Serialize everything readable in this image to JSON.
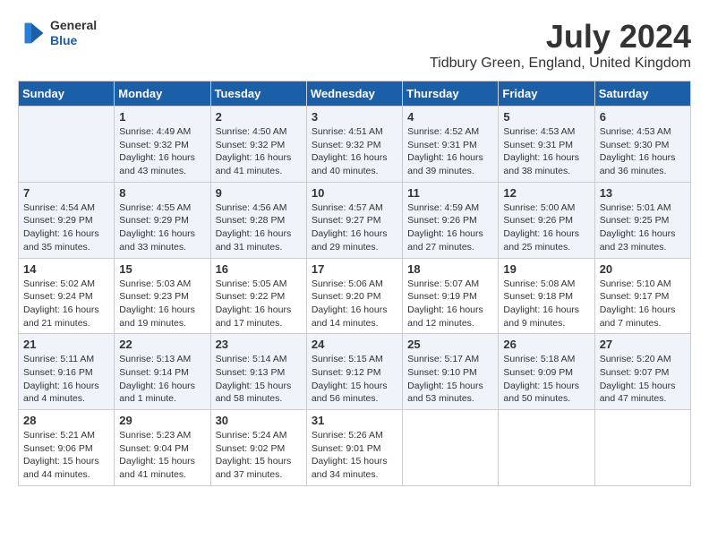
{
  "header": {
    "logo": {
      "general": "General",
      "blue": "Blue"
    },
    "title": "July 2024",
    "location": "Tidbury Green, England, United Kingdom"
  },
  "calendar": {
    "headers": [
      "Sunday",
      "Monday",
      "Tuesday",
      "Wednesday",
      "Thursday",
      "Friday",
      "Saturday"
    ],
    "weeks": [
      [
        {
          "day": "",
          "sunrise": "",
          "sunset": "",
          "daylight": ""
        },
        {
          "day": "1",
          "sunrise": "Sunrise: 4:49 AM",
          "sunset": "Sunset: 9:32 PM",
          "daylight": "Daylight: 16 hours and 43 minutes."
        },
        {
          "day": "2",
          "sunrise": "Sunrise: 4:50 AM",
          "sunset": "Sunset: 9:32 PM",
          "daylight": "Daylight: 16 hours and 41 minutes."
        },
        {
          "day": "3",
          "sunrise": "Sunrise: 4:51 AM",
          "sunset": "Sunset: 9:32 PM",
          "daylight": "Daylight: 16 hours and 40 minutes."
        },
        {
          "day": "4",
          "sunrise": "Sunrise: 4:52 AM",
          "sunset": "Sunset: 9:31 PM",
          "daylight": "Daylight: 16 hours and 39 minutes."
        },
        {
          "day": "5",
          "sunrise": "Sunrise: 4:53 AM",
          "sunset": "Sunset: 9:31 PM",
          "daylight": "Daylight: 16 hours and 38 minutes."
        },
        {
          "day": "6",
          "sunrise": "Sunrise: 4:53 AM",
          "sunset": "Sunset: 9:30 PM",
          "daylight": "Daylight: 16 hours and 36 minutes."
        }
      ],
      [
        {
          "day": "7",
          "sunrise": "Sunrise: 4:54 AM",
          "sunset": "Sunset: 9:29 PM",
          "daylight": "Daylight: 16 hours and 35 minutes."
        },
        {
          "day": "8",
          "sunrise": "Sunrise: 4:55 AM",
          "sunset": "Sunset: 9:29 PM",
          "daylight": "Daylight: 16 hours and 33 minutes."
        },
        {
          "day": "9",
          "sunrise": "Sunrise: 4:56 AM",
          "sunset": "Sunset: 9:28 PM",
          "daylight": "Daylight: 16 hours and 31 minutes."
        },
        {
          "day": "10",
          "sunrise": "Sunrise: 4:57 AM",
          "sunset": "Sunset: 9:27 PM",
          "daylight": "Daylight: 16 hours and 29 minutes."
        },
        {
          "day": "11",
          "sunrise": "Sunrise: 4:59 AM",
          "sunset": "Sunset: 9:26 PM",
          "daylight": "Daylight: 16 hours and 27 minutes."
        },
        {
          "day": "12",
          "sunrise": "Sunrise: 5:00 AM",
          "sunset": "Sunset: 9:26 PM",
          "daylight": "Daylight: 16 hours and 25 minutes."
        },
        {
          "day": "13",
          "sunrise": "Sunrise: 5:01 AM",
          "sunset": "Sunset: 9:25 PM",
          "daylight": "Daylight: 16 hours and 23 minutes."
        }
      ],
      [
        {
          "day": "14",
          "sunrise": "Sunrise: 5:02 AM",
          "sunset": "Sunset: 9:24 PM",
          "daylight": "Daylight: 16 hours and 21 minutes."
        },
        {
          "day": "15",
          "sunrise": "Sunrise: 5:03 AM",
          "sunset": "Sunset: 9:23 PM",
          "daylight": "Daylight: 16 hours and 19 minutes."
        },
        {
          "day": "16",
          "sunrise": "Sunrise: 5:05 AM",
          "sunset": "Sunset: 9:22 PM",
          "daylight": "Daylight: 16 hours and 17 minutes."
        },
        {
          "day": "17",
          "sunrise": "Sunrise: 5:06 AM",
          "sunset": "Sunset: 9:20 PM",
          "daylight": "Daylight: 16 hours and 14 minutes."
        },
        {
          "day": "18",
          "sunrise": "Sunrise: 5:07 AM",
          "sunset": "Sunset: 9:19 PM",
          "daylight": "Daylight: 16 hours and 12 minutes."
        },
        {
          "day": "19",
          "sunrise": "Sunrise: 5:08 AM",
          "sunset": "Sunset: 9:18 PM",
          "daylight": "Daylight: 16 hours and 9 minutes."
        },
        {
          "day": "20",
          "sunrise": "Sunrise: 5:10 AM",
          "sunset": "Sunset: 9:17 PM",
          "daylight": "Daylight: 16 hours and 7 minutes."
        }
      ],
      [
        {
          "day": "21",
          "sunrise": "Sunrise: 5:11 AM",
          "sunset": "Sunset: 9:16 PM",
          "daylight": "Daylight: 16 hours and 4 minutes."
        },
        {
          "day": "22",
          "sunrise": "Sunrise: 5:13 AM",
          "sunset": "Sunset: 9:14 PM",
          "daylight": "Daylight: 16 hours and 1 minute."
        },
        {
          "day": "23",
          "sunrise": "Sunrise: 5:14 AM",
          "sunset": "Sunset: 9:13 PM",
          "daylight": "Daylight: 15 hours and 58 minutes."
        },
        {
          "day": "24",
          "sunrise": "Sunrise: 5:15 AM",
          "sunset": "Sunset: 9:12 PM",
          "daylight": "Daylight: 15 hours and 56 minutes."
        },
        {
          "day": "25",
          "sunrise": "Sunrise: 5:17 AM",
          "sunset": "Sunset: 9:10 PM",
          "daylight": "Daylight: 15 hours and 53 minutes."
        },
        {
          "day": "26",
          "sunrise": "Sunrise: 5:18 AM",
          "sunset": "Sunset: 9:09 PM",
          "daylight": "Daylight: 15 hours and 50 minutes."
        },
        {
          "day": "27",
          "sunrise": "Sunrise: 5:20 AM",
          "sunset": "Sunset: 9:07 PM",
          "daylight": "Daylight: 15 hours and 47 minutes."
        }
      ],
      [
        {
          "day": "28",
          "sunrise": "Sunrise: 5:21 AM",
          "sunset": "Sunset: 9:06 PM",
          "daylight": "Daylight: 15 hours and 44 minutes."
        },
        {
          "day": "29",
          "sunrise": "Sunrise: 5:23 AM",
          "sunset": "Sunset: 9:04 PM",
          "daylight": "Daylight: 15 hours and 41 minutes."
        },
        {
          "day": "30",
          "sunrise": "Sunrise: 5:24 AM",
          "sunset": "Sunset: 9:02 PM",
          "daylight": "Daylight: 15 hours and 37 minutes."
        },
        {
          "day": "31",
          "sunrise": "Sunrise: 5:26 AM",
          "sunset": "Sunset: 9:01 PM",
          "daylight": "Daylight: 15 hours and 34 minutes."
        },
        {
          "day": "",
          "sunrise": "",
          "sunset": "",
          "daylight": ""
        },
        {
          "day": "",
          "sunrise": "",
          "sunset": "",
          "daylight": ""
        },
        {
          "day": "",
          "sunrise": "",
          "sunset": "",
          "daylight": ""
        }
      ]
    ]
  }
}
